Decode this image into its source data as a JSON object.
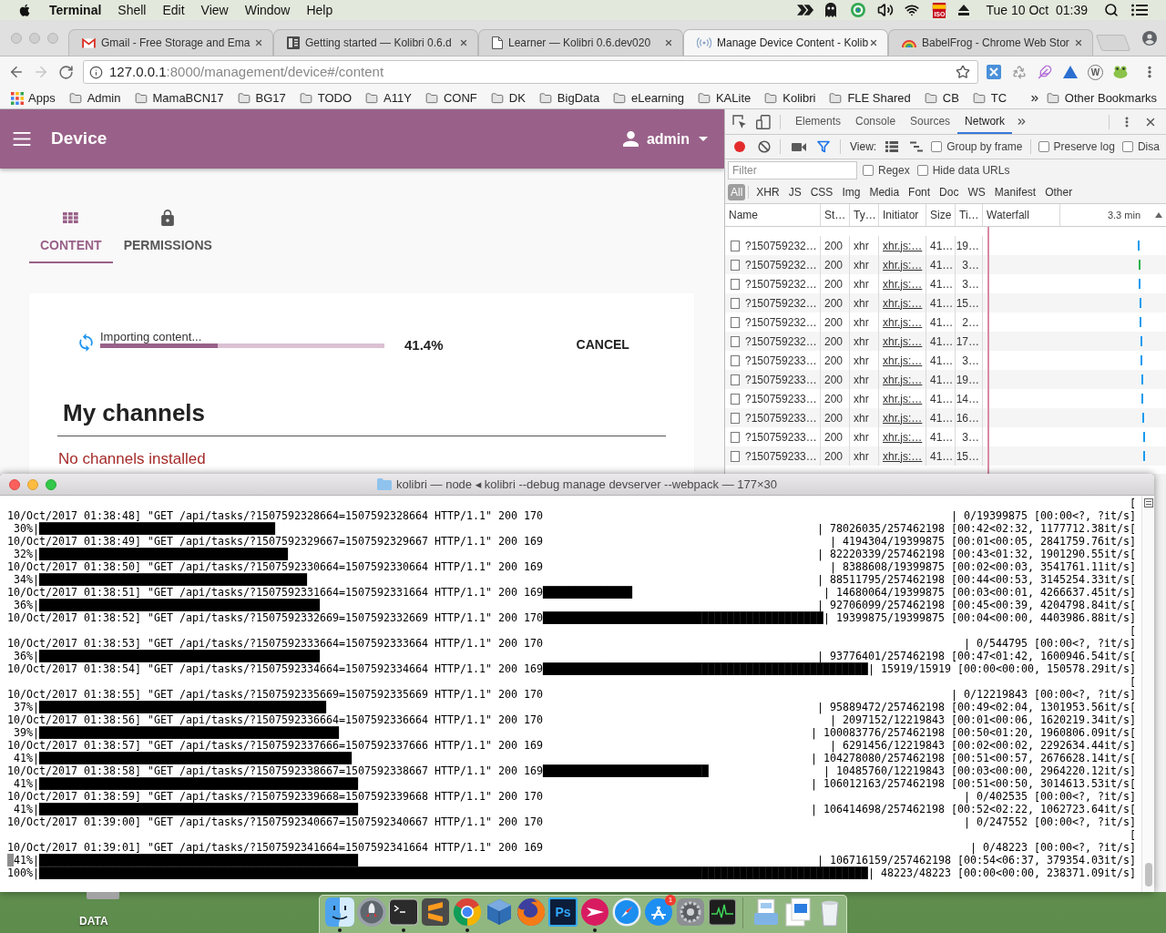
{
  "menu_bar": {
    "app": "Terminal",
    "menus": [
      "Shell",
      "Edit",
      "View",
      "Window",
      "Help"
    ],
    "input_source": "ISO",
    "clock": "Tue 10 Oct  01:39"
  },
  "browser": {
    "tabs": [
      {
        "title": "Gmail - Free Storage and Ema",
        "kind": "mail",
        "selected": false
      },
      {
        "title": "Getting started — Kolibri 0.6.d",
        "kind": "book",
        "selected": false
      },
      {
        "title": "Learner — Kolibri 0.6.dev020",
        "kind": "page",
        "selected": false
      },
      {
        "title": "Manage Device Content - Kolib",
        "kind": "broadcast",
        "selected": true
      },
      {
        "title": "BabelFrog - Chrome Web Stor",
        "kind": "rainbow",
        "selected": false
      }
    ],
    "url": {
      "host": "127.0.0.1",
      "path": ":8000/management/device#/content"
    },
    "extension_label": "W",
    "bookmarks": [
      {
        "label": "Apps",
        "kind": "apps"
      },
      {
        "label": "Admin",
        "kind": "folder"
      },
      {
        "label": "MamaBCN17",
        "kind": "folder"
      },
      {
        "label": "BG17",
        "kind": "folder"
      },
      {
        "label": "TODO",
        "kind": "folder"
      },
      {
        "label": "A11Y",
        "kind": "folder"
      },
      {
        "label": "CONF",
        "kind": "folder"
      },
      {
        "label": "DK",
        "kind": "folder"
      },
      {
        "label": "BigData",
        "kind": "folder"
      },
      {
        "label": "eLearning",
        "kind": "folder"
      },
      {
        "label": "KALite",
        "kind": "folder"
      },
      {
        "label": "Kolibri",
        "kind": "folder"
      },
      {
        "label": "FLE Shared",
        "kind": "folder"
      },
      {
        "label": "CB",
        "kind": "folder"
      },
      {
        "label": "TC",
        "kind": "folder"
      }
    ],
    "other_bookmarks": "Other Bookmarks"
  },
  "app": {
    "title": "Device",
    "user": "admin",
    "tabs": [
      {
        "label": "CONTENT",
        "kind": "content",
        "selected": true
      },
      {
        "label": "PERMISSIONS",
        "kind": "permissions",
        "selected": false
      }
    ],
    "task": {
      "label": "Importing content...",
      "level": 0.414,
      "reading": "41.4%",
      "button": "CANCEL"
    },
    "heading": "My channels",
    "empty_message": "No channels installed"
  },
  "devtools": {
    "panels": [
      {
        "label": "Elements",
        "selected": false
      },
      {
        "label": "Console",
        "selected": false
      },
      {
        "label": "Sources",
        "selected": false
      },
      {
        "label": "Network",
        "selected": true
      }
    ],
    "recording": true,
    "view_label": "View:",
    "options": [
      {
        "label": "Group by frame",
        "checked": false
      },
      {
        "label": "Preserve log",
        "checked": false
      },
      {
        "label": "Disa",
        "checked": false
      }
    ],
    "filter": {
      "placeholder": "Filter"
    },
    "filter_options": [
      {
        "label": "Regex",
        "checked": false
      },
      {
        "label": "Hide data URLs",
        "checked": false
      }
    ],
    "types": [
      {
        "label": "All",
        "selected": true
      },
      {
        "label": "XHR",
        "selected": false
      },
      {
        "label": "JS",
        "selected": false
      },
      {
        "label": "CSS",
        "selected": false
      },
      {
        "label": "Img",
        "selected": false
      },
      {
        "label": "Media",
        "selected": false
      },
      {
        "label": "Font",
        "selected": false
      },
      {
        "label": "Doc",
        "selected": false
      },
      {
        "label": "WS",
        "selected": false
      },
      {
        "label": "Manifest",
        "selected": false
      },
      {
        "label": "Other",
        "selected": false
      }
    ],
    "columns": [
      "Name",
      "St…",
      "Ty…",
      "Initiator",
      "Size",
      "Ti…",
      "Waterfall"
    ],
    "timeline_label": "3.3 min",
    "rows": [
      {
        "name": "?150759232…",
        "status": "200",
        "type": "xhr",
        "initiator": "xhr.js:…",
        "size": "41…",
        "time": "19…",
        "color": "#1a9bf0"
      },
      {
        "name": "?150759232…",
        "status": "200",
        "type": "xhr",
        "initiator": "xhr.js:…",
        "size": "41…",
        "time": "3…",
        "color": "#22b04b"
      },
      {
        "name": "?150759232…",
        "status": "200",
        "type": "xhr",
        "initiator": "xhr.js:…",
        "size": "41…",
        "time": "3…",
        "color": "#1a9bf0"
      },
      {
        "name": "?150759232…",
        "status": "200",
        "type": "xhr",
        "initiator": "xhr.js:…",
        "size": "41…",
        "time": "15…",
        "color": "#1a9bf0"
      },
      {
        "name": "?150759232…",
        "status": "200",
        "type": "xhr",
        "initiator": "xhr.js:…",
        "size": "41…",
        "time": "2…",
        "color": "#1a9bf0"
      },
      {
        "name": "?150759232…",
        "status": "200",
        "type": "xhr",
        "initiator": "xhr.js:…",
        "size": "41…",
        "time": "17…",
        "color": "#1a9bf0"
      },
      {
        "name": "?150759233…",
        "status": "200",
        "type": "xhr",
        "initiator": "xhr.js:…",
        "size": "41…",
        "time": "3…",
        "color": "#1a9bf0"
      },
      {
        "name": "?150759233…",
        "status": "200",
        "type": "xhr",
        "initiator": "xhr.js:…",
        "size": "41…",
        "time": "19…",
        "color": "#1a9bf0"
      },
      {
        "name": "?150759233…",
        "status": "200",
        "type": "xhr",
        "initiator": "xhr.js:…",
        "size": "41…",
        "time": "14…",
        "color": "#1a9bf0"
      },
      {
        "name": "?150759233…",
        "status": "200",
        "type": "xhr",
        "initiator": "xhr.js:…",
        "size": "41…",
        "time": "16…",
        "color": "#1a9bf0"
      },
      {
        "name": "?150759233…",
        "status": "200",
        "type": "xhr",
        "initiator": "xhr.js:…",
        "size": "41…",
        "time": "3…",
        "color": "#1a9bf0"
      },
      {
        "name": "?150759233…",
        "status": "200",
        "type": "xhr",
        "initiator": "xhr.js:…",
        "size": "41…",
        "time": "15…",
        "color": "#1a9bf0"
      }
    ]
  },
  "terminal": {
    "title": "kolibri — node ◂ kolibri --debug manage devserver --webpack — 177×30",
    "lines": [
      {
        "cursor": false,
        "right": "["
      },
      {
        "cursor": false,
        "text": "10/Oct/2017 01:38:48] \"GET /api/tasks/?1507592328664=1507592328664 HTTP/1.1\" 200 170",
        "right": "| 0/19399875 [00:00<?, ?it/s]"
      },
      {
        "cursor": false,
        "text": " 30%|█████████████████████████████████████",
        "right": "| 78026035/257462198 [00:42<02:32, 1177712.38it/s["
      },
      {
        "cursor": false,
        "text": "10/Oct/2017 01:38:49] \"GET /api/tasks/?1507592329667=1507592329667 HTTP/1.1\" 200 169",
        "right": "| 4194304/19399875 [00:01<00:05, 2841759.76it/s]"
      },
      {
        "cursor": false,
        "text": " 32%|███████████████████████████████████████",
        "right": "| 82220339/257462198 [00:43<01:32, 1901290.55it/s["
      },
      {
        "cursor": false,
        "text": "10/Oct/2017 01:38:50] \"GET /api/tasks/?1507592330664=1507592330664 HTTP/1.1\" 200 169",
        "right": "| 8388608/19399875 [00:02<00:03, 3541761.11it/s]"
      },
      {
        "cursor": false,
        "text": " 34%|██████████████████████████████████████████",
        "right": "| 88511795/257462198 [00:44<00:53, 3145254.33it/s["
      },
      {
        "cursor": false,
        "text": "10/Oct/2017 01:38:51] \"GET /api/tasks/?1507592331664=1507592331664 HTTP/1.1\" 200 169██████████████",
        "right": "| 14680064/19399875 [00:03<00:01, 4266637.45it/s]"
      },
      {
        "cursor": false,
        "text": " 36%|████████████████████████████████████████████",
        "right": "| 92706099/257462198 [00:45<00:39, 4204798.84it/s["
      },
      {
        "cursor": false,
        "text": "10/Oct/2017 01:38:52] \"GET /api/tasks/?1507592332669=1507592332669 HTTP/1.1\" 200 170████████████████████████████████████████████",
        "right": "| 19399875/19399875 [00:04<00:00, 4403986.88it/s]"
      },
      {
        "cursor": false,
        "right": "["
      },
      {
        "cursor": false,
        "text": "10/Oct/2017 01:38:53] \"GET /api/tasks/?1507592333664=1507592333664 HTTP/1.1\" 200 170",
        "right": "| 0/544795 [00:00<?, ?it/s]"
      },
      {
        "cursor": false,
        "text": " 36%|████████████████████████████████████████████",
        "right": "| 93776401/257462198 [00:47<01:42, 1600946.54it/s["
      },
      {
        "cursor": false,
        "text": "10/Oct/2017 01:38:54] \"GET /api/tasks/?1507592334664=1507592334664 HTTP/1.1\" 200 169███████████████████████████████████████████████████",
        "right": "| 15919/15919 [00:00<00:00, 150578.29it/s]"
      },
      {
        "cursor": false,
        "right": "["
      },
      {
        "cursor": false,
        "text": "10/Oct/2017 01:38:55] \"GET /api/tasks/?1507592335669=1507592335669 HTTP/1.1\" 200 170",
        "right": "| 0/12219843 [00:00<?, ?it/s]"
      },
      {
        "cursor": false,
        "text": " 37%|█████████████████████████████████████████████",
        "right": "| 95889472/257462198 [00:49<02:04, 1301953.56it/s["
      },
      {
        "cursor": false,
        "text": "10/Oct/2017 01:38:56] \"GET /api/tasks/?1507592336664=1507592336664 HTTP/1.1\" 200 170",
        "right": "| 2097152/12219843 [00:01<00:06, 1620219.34it/s]"
      },
      {
        "cursor": false,
        "text": " 39%|███████████████████████████████████████████████",
        "right": "| 100083776/257462198 [00:50<01:20, 1960806.09it/s["
      },
      {
        "cursor": false,
        "text": "10/Oct/2017 01:38:57] \"GET /api/tasks/?1507592337666=1507592337666 HTTP/1.1\" 200 169",
        "right": "| 6291456/12219843 [00:02<00:02, 2292634.44it/s]"
      },
      {
        "cursor": false,
        "text": " 41%|█████████████████████████████████████████████████",
        "right": "| 104278080/257462198 [00:51<00:57, 2676628.14it/s["
      },
      {
        "cursor": false,
        "text": "10/Oct/2017 01:38:58] \"GET /api/tasks/?1507592338667=1507592338667 HTTP/1.1\" 200 169██████████████████████████",
        "right": "| 10485760/12219843 [00:03<00:00, 2964220.12it/s]"
      },
      {
        "cursor": false,
        "text": " 41%|██████████████████████████████████████████████████",
        "right": "| 106012163/257462198 [00:51<00:50, 3014613.53it/s["
      },
      {
        "cursor": false,
        "text": "10/Oct/2017 01:38:59] \"GET /api/tasks/?1507592339668=1507592339668 HTTP/1.1\" 200 170",
        "right": "| 0/402535 [00:00<?, ?it/s]"
      },
      {
        "cursor": false,
        "text": " 41%|██████████████████████████████████████████████████",
        "right": "| 106414698/257462198 [00:52<02:22, 1062723.64it/s["
      },
      {
        "cursor": false,
        "text": "10/Oct/2017 01:39:00] \"GET /api/tasks/?1507592340667=1507592340667 HTTP/1.1\" 200 170",
        "right": "| 0/247552 [00:00<?, ?it/s]"
      },
      {
        "cursor": false,
        "right": "["
      },
      {
        "cursor": false,
        "text": "10/Oct/2017 01:39:01] \"GET /api/tasks/?1507592341664=1507592341664 HTTP/1.1\" 200 169",
        "right": "| 0/48223 [00:00<?, ?it/s]"
      },
      {
        "cursor": true,
        "text": "41%|██████████████████████████████████████████████████",
        "right": "| 106716159/257462198 [00:54<06:37, 379354.03it/s]"
      },
      {
        "cursor": false,
        "text": "100%|██████████████████████████████████████████████████████████████████████████████████████████████████████████████████████████████████",
        "right": "| 48223/48223 [00:00<00:00, 238371.09it/s]"
      }
    ]
  },
  "desktop": {
    "drive": "DATA"
  },
  "dock": [
    {
      "kind": "face",
      "running": true
    },
    {
      "kind": "rocket",
      "running": false
    },
    {
      "kind": "terminal",
      "running": true
    },
    {
      "kind": "zigzag",
      "running": false
    },
    {
      "kind": "round-logo",
      "running": true
    },
    {
      "kind": "cube",
      "running": false
    },
    {
      "kind": "swirl",
      "running": false
    },
    {
      "kind": "ps-tile",
      "running": false,
      "label": "Ps"
    },
    {
      "kind": "plane",
      "running": true
    },
    {
      "kind": "compass",
      "running": false
    },
    {
      "kind": "a-circle",
      "running": false,
      "badge": "1"
    },
    {
      "kind": "gear",
      "running": false
    },
    {
      "kind": "pulse",
      "running": false
    },
    {
      "kind": "doc-folder",
      "running": false
    },
    {
      "kind": "doc-stack",
      "running": false
    },
    {
      "kind": "trash",
      "running": false
    }
  ]
}
